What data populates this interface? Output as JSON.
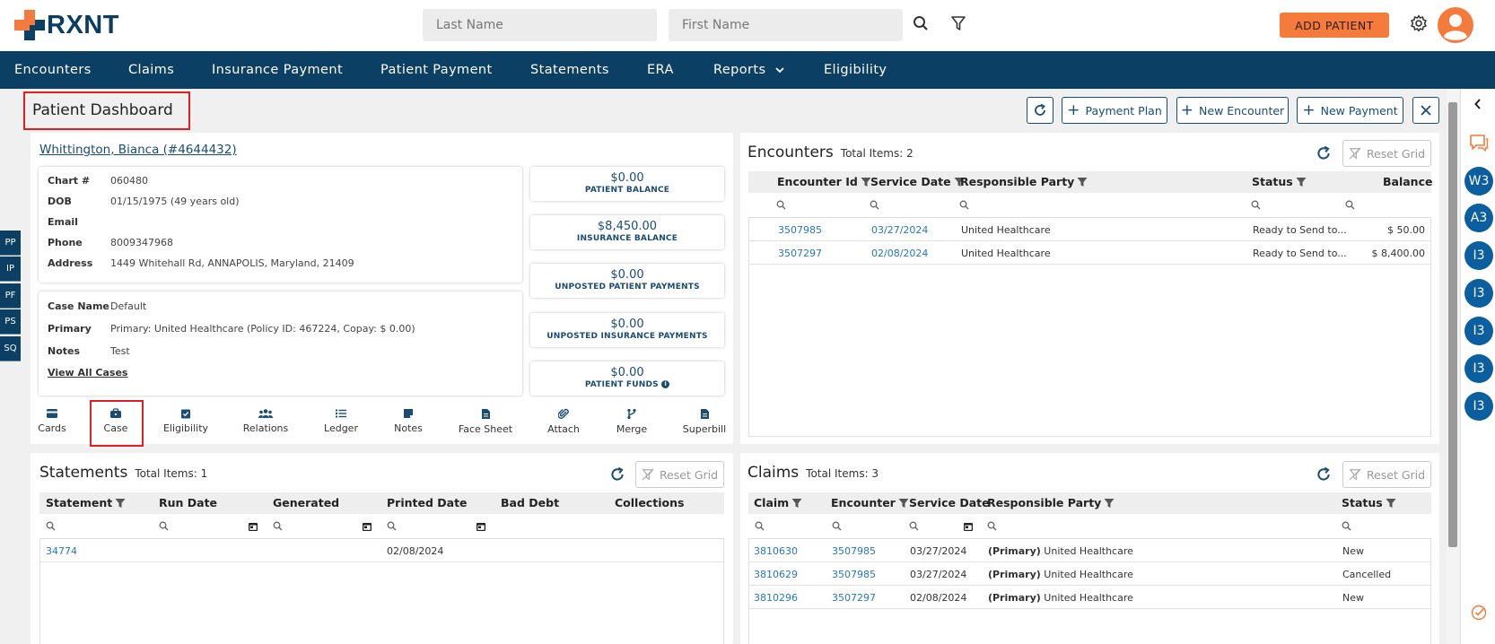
{
  "app": {
    "logo_text": "RXNT",
    "search": {
      "last_name_placeholder": "Last Name",
      "first_name_placeholder": "First Name"
    },
    "add_patient_label": "ADD PATIENT"
  },
  "nav": {
    "items": [
      "Encounters",
      "Claims",
      "Insurance Payment",
      "Patient Payment",
      "Statements",
      "ERA",
      "Reports",
      "Eligibility"
    ]
  },
  "side_tabs": [
    "PP",
    "IP",
    "PF",
    "PS",
    "SQ"
  ],
  "right_rail": {
    "badges": [
      "W3",
      "A3",
      "I3",
      "I3",
      "I3",
      "I3",
      "I3"
    ]
  },
  "page": {
    "title": "Patient Dashboard",
    "toolbar": {
      "payment_plan": "Payment Plan",
      "new_encounter": "New Encounter",
      "new_payment": "New Payment"
    }
  },
  "patient": {
    "name_link": "Whittington, Bianca (#4644432)",
    "details": [
      {
        "label": "Chart #",
        "value": "060480"
      },
      {
        "label": "DOB",
        "value": "01/15/1975 (49 years old)"
      },
      {
        "label": "Email",
        "value": ""
      },
      {
        "label": "Phone",
        "value": "8009347968"
      },
      {
        "label": "Address",
        "value": "1449 Whitehall Rd, ANNAPOLIS, Maryland, 21409"
      }
    ],
    "case": [
      {
        "label": "Case Name",
        "value": "Default"
      },
      {
        "label": "Primary",
        "value": "Primary: United Healthcare (Policy ID: 467224, Copay: $ 0.00)"
      },
      {
        "label": "Notes",
        "value": "Test"
      }
    ],
    "view_all_cases": "View All Cases",
    "balances": [
      {
        "value": "$0.00",
        "label": "PATIENT BALANCE"
      },
      {
        "value": "$8,450.00",
        "label": "INSURANCE BALANCE"
      },
      {
        "value": "$0.00",
        "label": "UNPOSTED PATIENT PAYMENTS"
      },
      {
        "value": "$0.00",
        "label": "UNPOSTED INSURANCE PAYMENTS"
      },
      {
        "value": "$0.00",
        "label": "PATIENT FUNDS"
      }
    ],
    "actions": [
      "Cards",
      "Case",
      "Eligibility",
      "Relations",
      "Ledger",
      "Notes",
      "Face Sheet",
      "Attach",
      "Merge",
      "Superbill"
    ]
  },
  "encounters": {
    "title": "Encounters",
    "count": "Total Items: 2",
    "reset_label": "Reset Grid",
    "columns": [
      "Encounter Id",
      "Service Date",
      "Responsible Party",
      "Status",
      "Balance"
    ],
    "rows": [
      {
        "id": "3507985",
        "date": "03/27/2024",
        "party": "United Healthcare",
        "status": "Ready to Send to...",
        "balance": "$ 50.00"
      },
      {
        "id": "3507297",
        "date": "02/08/2024",
        "party": "United Healthcare",
        "status": "Ready to Send to...",
        "balance": "$ 8,400.00"
      }
    ]
  },
  "statements": {
    "title": "Statements",
    "count": "Total Items: 1",
    "reset_label": "Reset Grid",
    "columns": [
      "Statement",
      "Run Date",
      "Generated",
      "Printed Date",
      "Bad Debt",
      "Collections"
    ],
    "rows": [
      {
        "statement": "34774",
        "run_date": "",
        "generated": "",
        "printed": "02/08/2024",
        "bad_debt": "",
        "collections": ""
      }
    ]
  },
  "claims": {
    "title": "Claims",
    "count": "Total Items: 3",
    "reset_label": "Reset Grid",
    "columns": [
      "Claim",
      "Encounter",
      "Service Date",
      "Responsible Party",
      "Status"
    ],
    "rows": [
      {
        "claim": "3810630",
        "encounter": "3507985",
        "date": "03/27/2024",
        "prefix": "(Primary)",
        "party": "United Healthcare",
        "status": "New"
      },
      {
        "claim": "3810629",
        "encounter": "3507985",
        "date": "03/27/2024",
        "prefix": "(Primary)",
        "party": "United Healthcare",
        "status": "Cancelled"
      },
      {
        "claim": "3810296",
        "encounter": "3507297",
        "date": "02/08/2024",
        "prefix": "(Primary)",
        "party": "United Healthcare",
        "status": "New"
      }
    ]
  },
  "colors": {
    "brand_navy": "#0b3f63",
    "accent_orange": "#f47b3b",
    "link_blue": "#2a76b8",
    "highlight_red": "#e02020"
  }
}
